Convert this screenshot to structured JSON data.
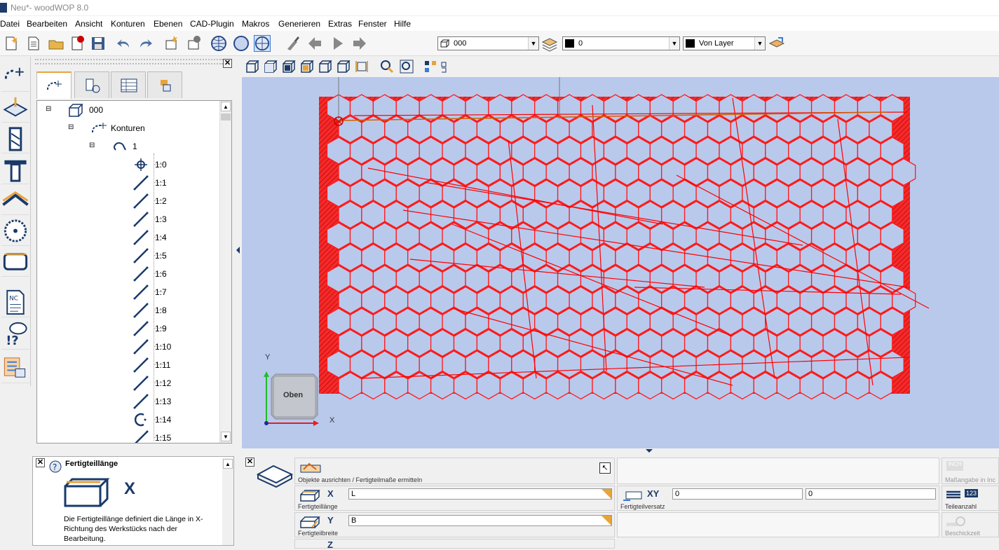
{
  "window": {
    "title": "Neu*- woodWOP 8.0"
  },
  "menu": {
    "items": [
      "Datei",
      "Bearbeiten",
      "Ansicht",
      "Konturen",
      "Ebenen",
      "CAD-Plugin",
      "Makros",
      "Generieren",
      "Extras",
      "Fenster",
      "Hilfe"
    ]
  },
  "toolbar": {
    "component_select": "000",
    "color_select": "0",
    "layer_select": "Von Layer"
  },
  "tree": {
    "root": "000",
    "konturen": "Konturen",
    "contour": "1",
    "items": [
      "1:0",
      "1:1",
      "1:2",
      "1:3",
      "1:4",
      "1:5",
      "1:6",
      "1:7",
      "1:8",
      "1:9",
      "1:10",
      "1:11",
      "1:12",
      "1:13",
      "1:14",
      "1:15"
    ]
  },
  "viewport": {
    "axis_y": "Y",
    "axis_x": "X",
    "cube_label": "Oben"
  },
  "help": {
    "title": "Fertigteillänge",
    "symbol": "X",
    "text": "Die Fertigteillänge definiert die Länge in X-Richtung des Werkstücks nach der Bearbeitung."
  },
  "props": {
    "align_label": "Objekte ausrichten / Fertigteilmaße ermitteln",
    "length_axis": "X",
    "length_value": "L",
    "length_label": "Fertigteillänge",
    "width_axis": "Y",
    "width_value": "B",
    "width_label": "Fertigteilbreite",
    "offset_axis": "XY",
    "offset_x": "0",
    "offset_y": "0",
    "offset_label": "Fertigteilversatz",
    "inch_label": "Maßangabe in Inc",
    "parts_label": "Teileanzahl",
    "parts_icon": "123",
    "time_label": "Beschickzeit",
    "height_axis": "Z"
  },
  "colors": {
    "contour": "#ff0000",
    "viewport": "#b9c9ec",
    "accent": "#e8a33a"
  }
}
